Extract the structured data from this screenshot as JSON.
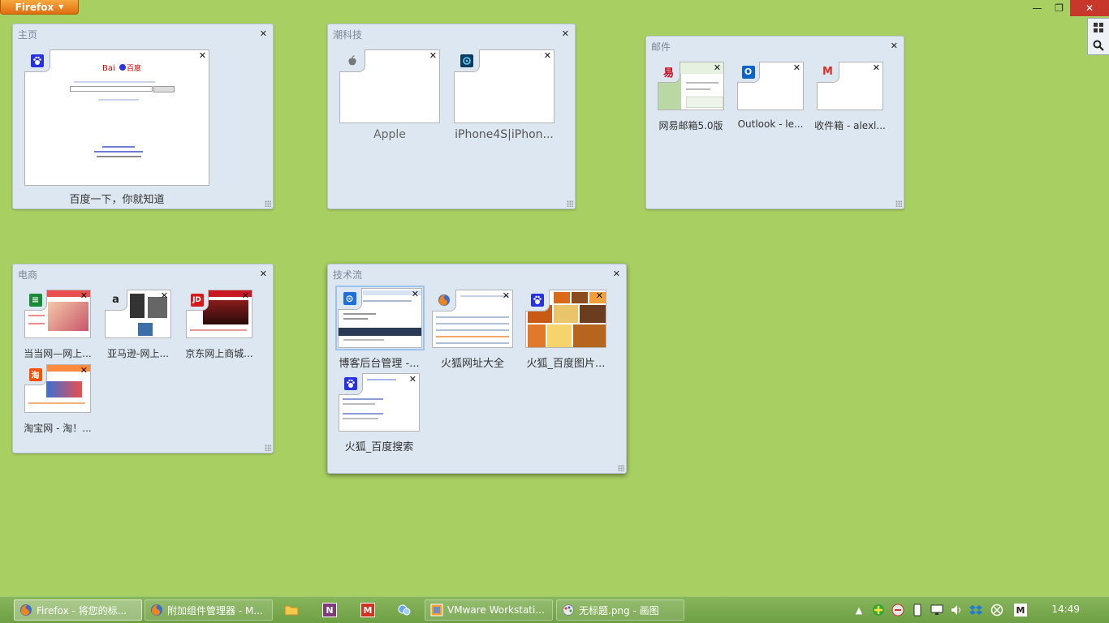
{
  "window": {
    "app_button_label": "Firefox",
    "minimize_symbol": "—",
    "restore_symbol": "❐",
    "close_symbol": "✕"
  },
  "side_tools": [
    {
      "icon": "grid-icon"
    },
    {
      "icon": "search-icon"
    }
  ],
  "groups": [
    {
      "title": "主页",
      "tabs": [
        {
          "label": "百度一下，你就知道",
          "favicon": "baidu-paw-icon",
          "color": "#2932e1"
        }
      ]
    },
    {
      "title": "潮科技",
      "tabs": [
        {
          "label": "Apple",
          "favicon": "apple-icon",
          "color": "#888888"
        },
        {
          "label": "iPhone4S|iPhon...",
          "favicon": "weiphone-icon",
          "color": "#1a7fc4"
        }
      ]
    },
    {
      "title": "邮件",
      "tabs": [
        {
          "label": "网易邮箱5.0版",
          "favicon": "netease-icon",
          "color": "#d0021b",
          "glyph": "易"
        },
        {
          "label": "Outlook - le...",
          "favicon": "outlook-icon",
          "color": "#0a64c8",
          "glyph": "O"
        },
        {
          "label": "收件箱 - alexl...",
          "favicon": "gmail-icon",
          "color": "#d93025",
          "glyph": "M"
        }
      ]
    },
    {
      "title": "电商",
      "tabs": [
        {
          "label": "当当网—网上...",
          "favicon": "dangdang-icon",
          "color": "#1a8a3a",
          "glyph": "≡"
        },
        {
          "label": "亚马逊-网上...",
          "favicon": "amazon-icon",
          "color": "#222222",
          "glyph": "a"
        },
        {
          "label": "京东网上商城...",
          "favicon": "jd-icon",
          "color": "#d71a1a",
          "glyph": "JD"
        },
        {
          "label": "淘宝网 - 淘！...",
          "favicon": "taobao-icon",
          "color": "#ff5000",
          "glyph": "淘"
        }
      ]
    },
    {
      "title": "技术流",
      "tabs": [
        {
          "label": "博客后台管理 -...",
          "favicon": "cnblogs-icon",
          "color": "#1e6fd9",
          "glyph": "⊙"
        },
        {
          "label": "火狐网址大全",
          "favicon": "firefox-icon",
          "color": "#e66000"
        },
        {
          "label": "火狐_百度图片...",
          "favicon": "baidu-paw-icon",
          "color": "#2932e1"
        },
        {
          "label": "火狐_百度搜索",
          "favicon": "baidu-paw-icon",
          "color": "#2932e1"
        }
      ]
    }
  ],
  "taskbar": {
    "items": [
      {
        "label": "Firefox - 将您的标...",
        "icon": "firefox-icon",
        "active": true
      },
      {
        "label": "附加组件管理器 - M...",
        "icon": "firefox-icon",
        "active": false
      },
      {
        "label": "VMware Workstati...",
        "icon": "vmware-icon",
        "active": false
      },
      {
        "label": "无标题.png - 画图",
        "icon": "paint-icon",
        "active": false
      }
    ],
    "pinned": [
      {
        "icon": "explorer-folder-icon"
      },
      {
        "icon": "onenote-icon",
        "glyph": "N"
      },
      {
        "icon": "mail-app-icon",
        "glyph": "M"
      },
      {
        "icon": "qq-icon"
      }
    ],
    "clock": "14:49"
  }
}
